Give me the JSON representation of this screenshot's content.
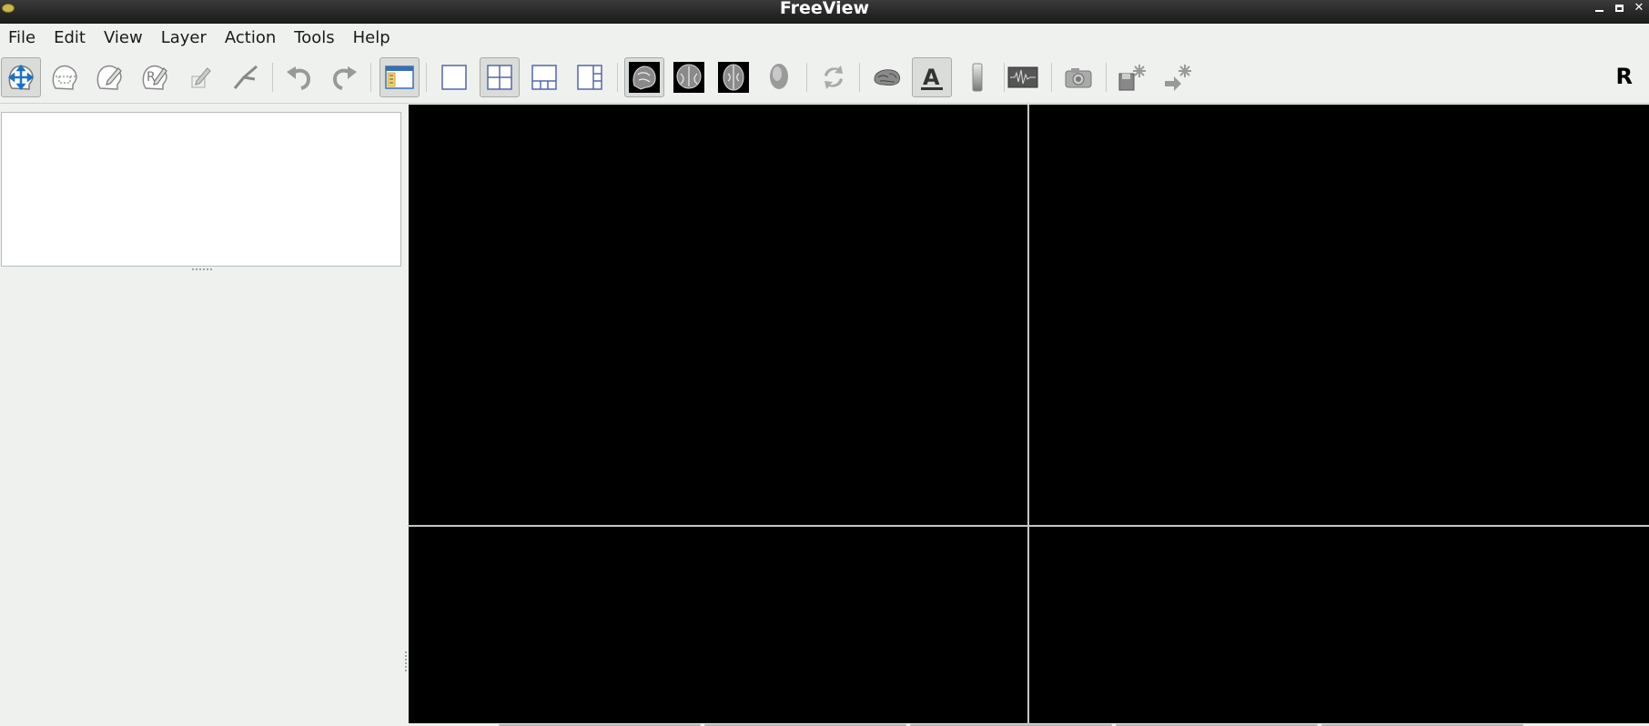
{
  "window": {
    "title": "FreeView",
    "icon": "freeview-app-icon",
    "controls": [
      "minimize-icon",
      "maximize-icon",
      "close-icon"
    ]
  },
  "menubar": {
    "items": [
      {
        "label": "File"
      },
      {
        "label": "Edit"
      },
      {
        "label": "View"
      },
      {
        "label": "Layer"
      },
      {
        "label": "Action"
      },
      {
        "label": "Tools"
      },
      {
        "label": "Help"
      }
    ]
  },
  "toolbar": {
    "tools": [
      {
        "name": "navigate-tool-icon",
        "checked": true
      },
      {
        "name": "voxel-edit-tool-icon",
        "checked": false
      },
      {
        "name": "recon-edit-tool-icon",
        "checked": false
      },
      {
        "name": "roi-edit-tool-icon",
        "checked": false
      },
      {
        "name": "point-set-edit-icon",
        "checked": false
      },
      {
        "name": "contour-tool-icon",
        "checked": false
      },
      {
        "name": "undo-icon",
        "checked": false
      },
      {
        "name": "redo-icon",
        "checked": false
      },
      {
        "name": "toggle-control-panel-icon",
        "checked": true
      },
      {
        "name": "layout-1x1-icon",
        "checked": false
      },
      {
        "name": "layout-2x2-icon",
        "checked": true
      },
      {
        "name": "layout-1and3-icon",
        "checked": false
      },
      {
        "name": "layout-1and3-horizontal-icon",
        "checked": false
      },
      {
        "name": "sagittal-view-icon",
        "checked": true
      },
      {
        "name": "coronal-view-icon",
        "checked": false
      },
      {
        "name": "axial-view-icon",
        "checked": false
      },
      {
        "name": "3d-view-icon",
        "checked": false
      },
      {
        "name": "reset-view-icon",
        "checked": false
      },
      {
        "name": "show-surface-icon",
        "checked": false
      },
      {
        "name": "show-coordinate-annotation-icon",
        "checked": true
      },
      {
        "name": "show-color-bar-icon",
        "checked": false
      },
      {
        "name": "show-command-console-icon",
        "checked": false
      },
      {
        "name": "save-screenshot-icon",
        "checked": false
      },
      {
        "name": "save-point-icon",
        "checked": false
      },
      {
        "name": "goto-point-icon",
        "checked": false
      }
    ],
    "orientation_label": "R"
  },
  "colors": {
    "background": "#eef1ee",
    "viewport": "#000000",
    "accent": "#1a73c8"
  }
}
